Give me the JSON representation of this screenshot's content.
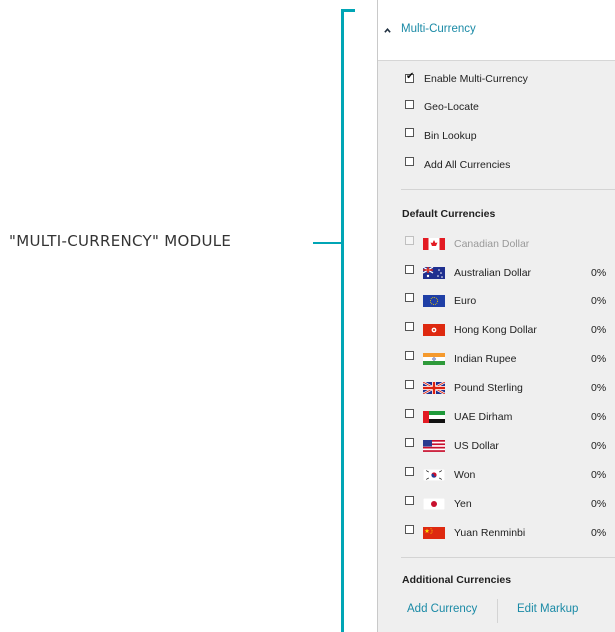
{
  "callout": {
    "label": "\"MULTI-CURRENCY\" MODULE"
  },
  "header": {
    "title": "Multi-Currency"
  },
  "options": [
    {
      "label": "Enable Multi-Currency",
      "checked": true
    },
    {
      "label": "Geo-Locate",
      "checked": false
    },
    {
      "label": "Bin Lookup",
      "checked": false
    },
    {
      "label": "Add All Currencies",
      "checked": false
    }
  ],
  "default_currencies": {
    "title": "Default Currencies",
    "items": [
      {
        "name": "Canadian Dollar",
        "percent": "",
        "flag": "canada-flag-icon",
        "disabled": true
      },
      {
        "name": "Australian Dollar",
        "percent": "0%",
        "flag": "australia-flag-icon"
      },
      {
        "name": "Euro",
        "percent": "0%",
        "flag": "eu-flag-icon"
      },
      {
        "name": "Hong Kong Dollar",
        "percent": "0%",
        "flag": "hong-kong-flag-icon"
      },
      {
        "name": "Indian Rupee",
        "percent": "0%",
        "flag": "india-flag-icon"
      },
      {
        "name": "Pound Sterling",
        "percent": "0%",
        "flag": "uk-flag-icon"
      },
      {
        "name": "UAE Dirham",
        "percent": "0%",
        "flag": "uae-flag-icon"
      },
      {
        "name": "US Dollar",
        "percent": "0%",
        "flag": "us-flag-icon"
      },
      {
        "name": "Won",
        "percent": "0%",
        "flag": "south-korea-flag-icon"
      },
      {
        "name": "Yen",
        "percent": "0%",
        "flag": "japan-flag-icon"
      },
      {
        "name": "Yuan Renminbi",
        "percent": "0%",
        "flag": "china-flag-icon"
      }
    ]
  },
  "additional_currencies": {
    "title": "Additional Currencies",
    "add_label": "Add Currency",
    "edit_label": "Edit Markup"
  },
  "colors": {
    "accent": "#00a5b5",
    "link": "#1a8aa6",
    "panel_bg": "#efefef"
  }
}
